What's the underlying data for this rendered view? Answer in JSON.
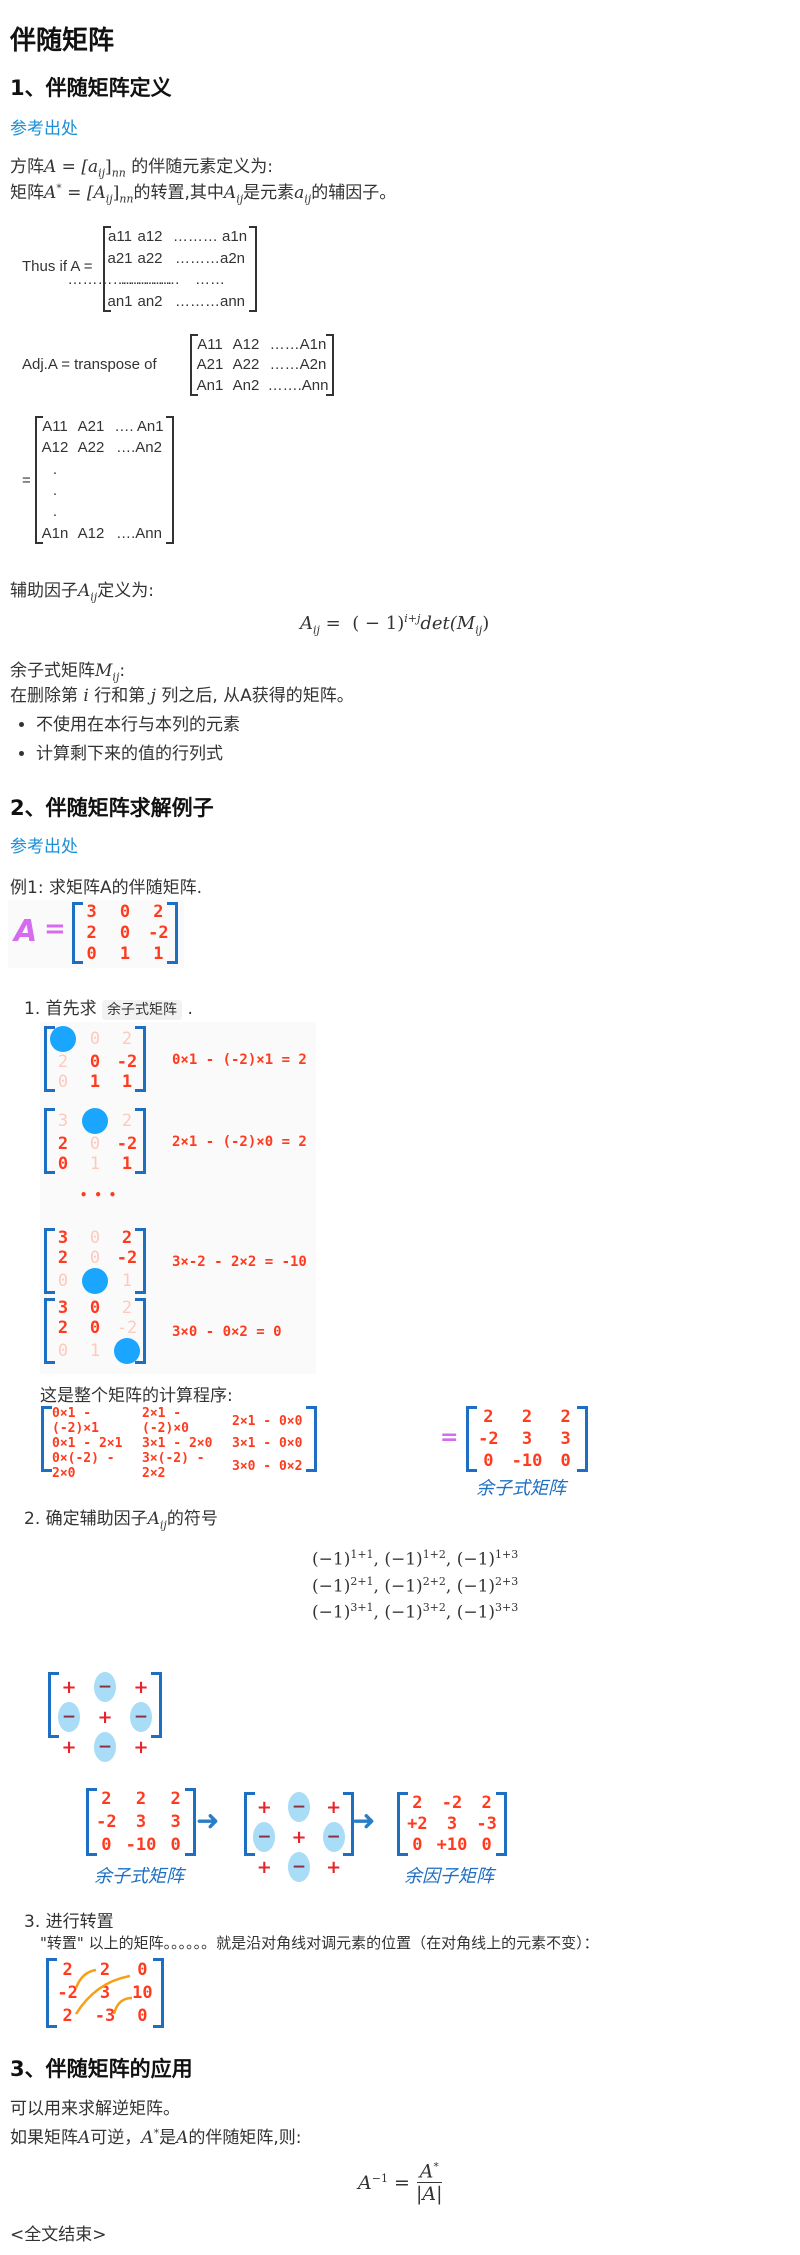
{
  "title": "伴随矩阵",
  "sec1": {
    "heading": "1、伴随矩阵定义",
    "ref": "参考出处",
    "l1a": "方阵",
    "l1m": "A = [a",
    "l1sub": "ij",
    "l1c": "]",
    "l1nn": "nn",
    "l1b": " 的伴随元素定义为:",
    "l2a": "矩阵",
    "l2m": "A",
    "l2s": "*",
    "l2m2": " = [A",
    "l2sub": "ij",
    "l2c": "]",
    "l2nn": "nn",
    "l2b": "的转置,其中",
    "l2m3": "A",
    "l2sub2": "ij",
    "l2c2": "是元素",
    "l2m4": "a",
    "l2sub3": "ij",
    "l2d": "的辅因子。",
    "thus_label": "Thus if A =",
    "thus_rows": [
      [
        "a11",
        "a12",
        "……… a1n"
      ],
      [
        "a21",
        "a22",
        "………a2n"
      ],
      [
        "…………………",
        "…………",
        "……"
      ],
      [
        "an1",
        "an2",
        "………ann"
      ]
    ],
    "adj_label": "Adj.A = transpose of",
    "adj_rows": [
      [
        "A11",
        "A12",
        "……A1n"
      ],
      [
        "A21",
        "A22",
        "……A2n"
      ],
      [
        "An1",
        "An2",
        "…….Ann"
      ]
    ],
    "eq_label": "=",
    "eq_rows": [
      [
        "A11",
        "A21",
        "…. An1"
      ],
      [
        "A12",
        "A22",
        "….An2"
      ],
      [
        ".",
        "",
        ""
      ],
      [
        ".",
        "",
        ""
      ],
      [
        ".",
        "",
        ""
      ],
      [
        "A1n",
        "A12",
        "….Ann"
      ]
    ],
    "cof_a": "辅助因子",
    "cof_m": "A",
    "cof_sub": "ij",
    "cof_b": "定义为:",
    "formula": {
      "lhs": "A",
      "lhs_sub": "ij",
      "eq": " =  ",
      "base": "( − 1)",
      "exp": "i+j",
      "det": "det(M",
      "det_sub": "ij",
      "close": ")"
    },
    "minor_a": "余子式矩阵",
    "minor_m": "M",
    "minor_sub": "ij",
    "minor_b": ":",
    "del_a": "在删除第 ",
    "del_i": "i",
    "del_b": " 行和第 ",
    "del_j": "j",
    "del_c": " 列之后, 从A获得的矩阵。",
    "bullets": [
      "不使用在本行与本列的元素",
      "计算剩下来的值的行列式"
    ]
  },
  "sec2": {
    "heading": "2、伴随矩阵求解例子",
    "ref": "参考出处",
    "example": "例1: 求矩阵A的伴随矩阵.",
    "a_label": "A",
    "a_eq": "=",
    "matrix_a": [
      [
        "3",
        "0",
        "2"
      ],
      [
        "2",
        "0",
        "-2"
      ],
      [
        "0",
        "1",
        "1"
      ]
    ],
    "step1_pre": "1. 首先求",
    "step1_code": "余子式矩阵",
    "step1_post": ".",
    "minors": [
      {
        "cells": [
          [
            "●",
            "0",
            "2"
          ],
          [
            "2",
            "0",
            "-2"
          ],
          [
            "0",
            "1",
            "1"
          ]
        ],
        "faint": [
          [
            0,
            1
          ],
          [
            0,
            2
          ],
          [
            1,
            0
          ],
          [
            2,
            0
          ]
        ],
        "calc": "0×1 - (-2)×1 = 2"
      },
      {
        "cells": [
          [
            "3",
            "●",
            "2"
          ],
          [
            "2",
            "0",
            "-2"
          ],
          [
            "0",
            "1",
            "1"
          ]
        ],
        "faint": [
          [
            0,
            0
          ],
          [
            0,
            2
          ],
          [
            1,
            1
          ],
          [
            2,
            1
          ]
        ],
        "calc": "2×1 - (-2)×0 = 2"
      },
      {
        "cells": [
          [
            "3",
            "0",
            "2"
          ],
          [
            "2",
            "0",
            "-2"
          ],
          [
            "0",
            "●",
            "1"
          ]
        ],
        "faint": [
          [
            0,
            1
          ],
          [
            1,
            1
          ],
          [
            2,
            0
          ],
          [
            2,
            2
          ]
        ],
        "calc": "3×-2 - 2×2 = -10"
      },
      {
        "cells": [
          [
            "3",
            "0",
            "2"
          ],
          [
            "2",
            "0",
            "-2"
          ],
          [
            "0",
            "1",
            "●"
          ]
        ],
        "faint": [
          [
            0,
            2
          ],
          [
            1,
            2
          ],
          [
            2,
            0
          ],
          [
            2,
            1
          ]
        ],
        "calc": "3×0 - 0×2 = 0"
      }
    ],
    "ellipsis": "• • •",
    "whole_label": "这是整个矩阵的计算程序:",
    "whole_rows": [
      [
        "0×1 - (-2)×1",
        "2×1 - (-2)×0",
        "2×1 - 0×0"
      ],
      [
        "0×1 - 2×1",
        "3×1 - 2×0",
        "3×1 - 0×0"
      ],
      [
        "0×(-2) - 2×0",
        "3×(-2) - 2×2",
        "3×0 - 0×2"
      ]
    ],
    "whole_eq": "=",
    "minor_matrix": [
      [
        "2",
        "2",
        "2"
      ],
      [
        "-2",
        "3",
        "3"
      ],
      [
        "0",
        "-10",
        "0"
      ]
    ],
    "minor_matrix_label": "余子式矩阵",
    "step2_a": "2. 确定辅助因子",
    "step2_m": "A",
    "step2_sub": "ij",
    "step2_b": "的符号",
    "sign_rows": [
      [
        [
          "1+1",
          "1+2",
          "1+3"
        ]
      ],
      [
        [
          "2+1",
          "2+2",
          "2+3"
        ]
      ],
      [
        [
          "3+1",
          "3+2",
          "3+3"
        ]
      ]
    ],
    "sign_base": "(−1)",
    "sign_matrix": [
      [
        "+",
        "−",
        "+"
      ],
      [
        "−",
        "+",
        "−"
      ],
      [
        "+",
        "−",
        "+"
      ]
    ],
    "cofactor_matrix": [
      [
        "2",
        "-2",
        "2"
      ],
      [
        "+2",
        "3",
        "-3"
      ],
      [
        "0",
        "+10",
        "0"
      ]
    ],
    "cofactor_label": "余因子矩阵",
    "step3": "3. 进行转置",
    "step3_desc": "\"转置\" 以上的矩阵。。。。。。就是沿对角线对调元素的位置（在对角线上的元素不变）：",
    "transposed": [
      [
        "2",
        "2",
        "0"
      ],
      [
        "-2",
        "3",
        "10"
      ],
      [
        "2",
        "-3",
        "0"
      ]
    ]
  },
  "sec3": {
    "heading": "3、伴随矩阵的应用",
    "p1": "可以用来求解逆矩阵。",
    "p2a": "如果矩阵",
    "p2m": "A",
    "p2b": "可逆，",
    "p2m2": "A",
    "p2s": "*",
    "p2c": "是",
    "p2m3": "A",
    "p2d": "的伴随矩阵,则:",
    "inv_lhs": "A",
    "inv_exp": "−1",
    "inv_eq": " = ",
    "inv_num": "A",
    "inv_num_s": "*",
    "inv_den": "|A|"
  },
  "end": "<全文结束>",
  "colors": {
    "link": "#1a8fd8",
    "red": "#ff3b1f",
    "bracket": "#1d6fc4",
    "pink": "#d66bf0",
    "dot": "#1aa6ff"
  }
}
